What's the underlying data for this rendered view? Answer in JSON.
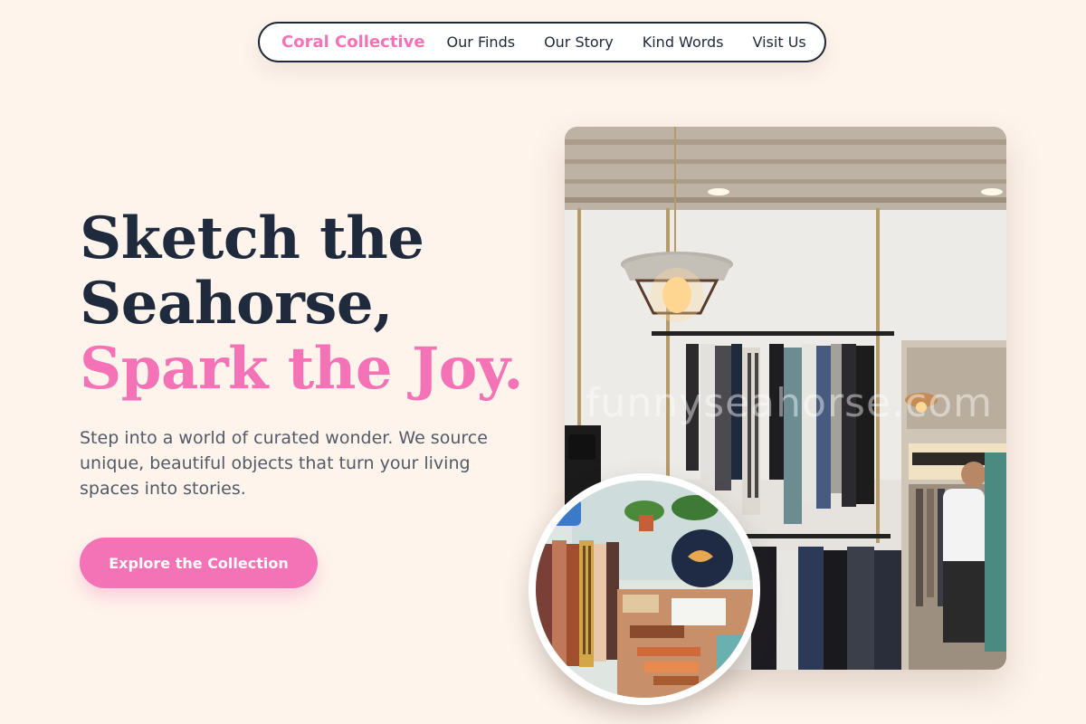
{
  "nav": {
    "brand": "Coral Collective",
    "links": [
      "Our Finds",
      "Our Story",
      "Kind Words",
      "Visit Us"
    ]
  },
  "hero": {
    "headline_line1": "Sketch the",
    "headline_line2": "Seahorse,",
    "headline_accent": "Spark the Joy.",
    "subtitle": "Step into a world of curated wonder. We source unique, beautiful objects that turn your living spaces into stories.",
    "cta_label": "Explore the Collection"
  },
  "watermark": "funnyseahorse.com",
  "colors": {
    "accent": "#f472b6",
    "heading": "#1f2a3c",
    "background": "#fef4ec",
    "nav_border": "#1f2937"
  }
}
